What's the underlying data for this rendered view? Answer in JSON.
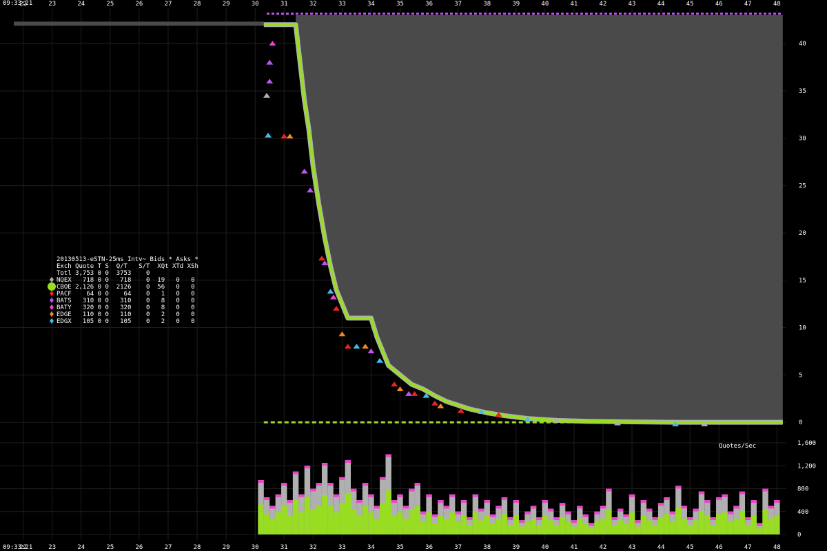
{
  "time_label": "09:33:21",
  "colors": {
    "background": "#000000",
    "grid": "#1e1e1e",
    "ask_area": "#4a4a4a",
    "NQEX": "#b0b0b0",
    "CBOE": "#99dd22",
    "PACF": "#ee2222",
    "BATS": "#bb55ee",
    "BATY": "#ee44cc",
    "EDGE": "#ee8822",
    "EDGX": "#44bbee"
  },
  "legend": {
    "title": "20130513-eSTN-25ms Intv~ Bids * Asks *",
    "header": "Exch Quote T S  Q/T   S/T  XQt XTd XSh",
    "total": "Totl 3,753 0 0  3753    0",
    "rows": [
      {
        "exch": "NQEX",
        "text": "NQEX   718 0 0   718    0  19   0   0",
        "color": "#b0b0b0",
        "big": false
      },
      {
        "exch": "CBOE",
        "text": "CBOE 2,126 0 0  2126    0  56   0   0",
        "color": "#99dd22",
        "big": true
      },
      {
        "exch": "PACF",
        "text": "PACF    64 0 0    64    0   1   0   0",
        "color": "#ee2222",
        "big": false
      },
      {
        "exch": "BATS",
        "text": "BATS   310 0 0   310    0   8   0   0",
        "color": "#bb55ee",
        "big": false
      },
      {
        "exch": "BATY",
        "text": "BATY   320 0 0   320    0   8   0   0",
        "color": "#ee44cc",
        "big": false
      },
      {
        "exch": "EDGE",
        "text": "EDGE   110 0 0   110    0   2   0   0",
        "color": "#ee8822",
        "big": false
      },
      {
        "exch": "EDGX",
        "text": "EDGX   105 0 0   105    0   2   0   0",
        "color": "#44bbee",
        "big": false
      }
    ]
  },
  "chart_data": [
    {
      "type": "line",
      "xlabel": "",
      "ylabel": "",
      "x_ticks": [
        "22",
        "23",
        "24",
        "25",
        "26",
        "27",
        "28",
        "29",
        "30",
        "31",
        "32",
        "33",
        "34",
        "35",
        "36",
        "37",
        "38",
        "39",
        "40",
        "41",
        "42",
        "43",
        "44",
        "45",
        "46",
        "47",
        "48"
      ],
      "xlim": [
        21.2,
        48.3
      ],
      "y_ticks": [
        0,
        5,
        10,
        15,
        20,
        25,
        30,
        35,
        40
      ],
      "ylim": [
        -0.5,
        43
      ],
      "grid": true,
      "ask_level": 43,
      "bid_series": {
        "name": "CBOE",
        "x": [
          30.3,
          31.4,
          31.55,
          31.7,
          31.85,
          32.0,
          32.2,
          32.4,
          32.6,
          32.8,
          33.0,
          33.2,
          33.4,
          33.6,
          33.8,
          34.0,
          34.2,
          34.4,
          34.6,
          35.0,
          35.4,
          35.8,
          36.2,
          36.6,
          37.0,
          37.4,
          38.0,
          38.6,
          39.4,
          40.4,
          41.5,
          43.0,
          44.5,
          46.0,
          48.2
        ],
        "y": [
          42,
          42,
          38,
          34,
          31,
          27,
          23,
          19.5,
          16.5,
          14,
          12.5,
          11,
          11,
          11,
          11,
          11,
          9,
          7.5,
          6,
          5,
          4,
          3.5,
          2.8,
          2.2,
          1.8,
          1.4,
          1.0,
          0.7,
          0.4,
          0.2,
          0.1,
          0.05,
          0,
          0,
          0
        ]
      },
      "markers": [
        {
          "exch": "NQEX",
          "x": 30.4,
          "y": 34.5
        },
        {
          "exch": "BATS",
          "x": 30.5,
          "y": 36
        },
        {
          "exch": "BATS",
          "x": 30.5,
          "y": 38
        },
        {
          "exch": "BATY",
          "x": 30.6,
          "y": 40
        },
        {
          "exch": "EDGX",
          "x": 30.45,
          "y": 30.3
        },
        {
          "exch": "EDGE",
          "x": 31.2,
          "y": 30.2
        },
        {
          "exch": "PACF",
          "x": 31.0,
          "y": 30.2
        },
        {
          "exch": "BATS",
          "x": 31.7,
          "y": 26.5
        },
        {
          "exch": "BATS",
          "x": 31.9,
          "y": 24.5
        },
        {
          "exch": "PACF",
          "x": 32.3,
          "y": 17.3
        },
        {
          "exch": "BATS",
          "x": 32.4,
          "y": 16.8
        },
        {
          "exch": "EDGX",
          "x": 32.6,
          "y": 13.8
        },
        {
          "exch": "BATY",
          "x": 32.7,
          "y": 13.2
        },
        {
          "exch": "PACF",
          "x": 32.8,
          "y": 12.0
        },
        {
          "exch": "EDGE",
          "x": 33.0,
          "y": 9.3
        },
        {
          "exch": "PACF",
          "x": 33.2,
          "y": 8.0
        },
        {
          "exch": "EDGX",
          "x": 33.5,
          "y": 8.0
        },
        {
          "exch": "EDGE",
          "x": 33.8,
          "y": 8.0
        },
        {
          "exch": "BATS",
          "x": 34.0,
          "y": 7.5
        },
        {
          "exch": "EDGX",
          "x": 34.3,
          "y": 6.5
        },
        {
          "exch": "PACF",
          "x": 34.8,
          "y": 4.0
        },
        {
          "exch": "EDGE",
          "x": 35.0,
          "y": 3.5
        },
        {
          "exch": "BATS",
          "x": 35.3,
          "y": 3.0
        },
        {
          "exch": "PACF",
          "x": 35.5,
          "y": 3.0
        },
        {
          "exch": "EDGX",
          "x": 35.9,
          "y": 2.8
        },
        {
          "exch": "PACF",
          "x": 36.2,
          "y": 2.0
        },
        {
          "exch": "EDGE",
          "x": 36.4,
          "y": 1.7
        },
        {
          "exch": "PACF",
          "x": 37.1,
          "y": 1.2
        },
        {
          "exch": "EDGX",
          "x": 37.8,
          "y": 1.1
        },
        {
          "exch": "PACF",
          "x": 38.4,
          "y": 0.8
        },
        {
          "exch": "EDGX",
          "x": 39.4,
          "y": 0.3
        },
        {
          "exch": "NQEX",
          "x": 40.4,
          "y": 0.2
        },
        {
          "exch": "NQEX",
          "x": 42.5,
          "y": -0.1
        },
        {
          "exch": "EDGX",
          "x": 44.5,
          "y": -0.2
        },
        {
          "exch": "NQEX",
          "x": 45.5,
          "y": -0.2
        }
      ]
    },
    {
      "type": "bar",
      "title": "Quotes/Sec",
      "y_ticks": [
        0,
        400,
        800,
        1200,
        1600
      ],
      "ylim": [
        0,
        1600
      ],
      "xlim": [
        21.2,
        48.3
      ],
      "x_ticks": [
        "22",
        "23",
        "24",
        "25",
        "26",
        "27",
        "28",
        "29",
        "30",
        "31",
        "32",
        "33",
        "34",
        "35",
        "36",
        "37",
        "38",
        "39",
        "40",
        "41",
        "42",
        "43",
        "44",
        "45",
        "46",
        "47",
        "48"
      ],
      "x": [
        30.2,
        30.4,
        30.6,
        30.8,
        31.0,
        31.2,
        31.4,
        31.6,
        31.8,
        32.0,
        32.2,
        32.4,
        32.6,
        32.8,
        33.0,
        33.2,
        33.4,
        33.6,
        33.8,
        34.0,
        34.2,
        34.4,
        34.6,
        34.8,
        35.0,
        35.2,
        35.4,
        35.6,
        35.8,
        36.0,
        36.2,
        36.4,
        36.6,
        36.8,
        37.0,
        37.2,
        37.4,
        37.6,
        37.8,
        38.0,
        38.2,
        38.4,
        38.6,
        38.8,
        39.0,
        39.2,
        39.4,
        39.6,
        39.8,
        40.0,
        40.2,
        40.4,
        40.6,
        40.8,
        41.0,
        41.2,
        41.4,
        41.6,
        41.8,
        42.0,
        42.2,
        42.4,
        42.6,
        42.8,
        43.0,
        43.2,
        43.4,
        43.6,
        43.8,
        44.0,
        44.2,
        44.4,
        44.6,
        44.8,
        45.0,
        45.2,
        45.4,
        45.6,
        45.8,
        46.0,
        46.2,
        46.4,
        46.6,
        46.8,
        47.0,
        47.2,
        47.4,
        47.6,
        47.8,
        48.0
      ],
      "values": [
        950,
        650,
        500,
        700,
        900,
        600,
        1100,
        700,
        1200,
        800,
        900,
        1250,
        900,
        700,
        1000,
        1300,
        800,
        600,
        900,
        700,
        500,
        1000,
        1400,
        600,
        700,
        500,
        800,
        900,
        400,
        700,
        350,
        600,
        500,
        700,
        400,
        600,
        300,
        700,
        450,
        600,
        350,
        500,
        650,
        300,
        600,
        250,
        400,
        500,
        300,
        600,
        450,
        300,
        550,
        400,
        250,
        500,
        350,
        200,
        400,
        500,
        800,
        300,
        450,
        350,
        700,
        250,
        600,
        450,
        300,
        550,
        650,
        400,
        850,
        500,
        300,
        450,
        750,
        600,
        300,
        650,
        700,
        400,
        500,
        750,
        300,
        600,
        200,
        800,
        500,
        600
      ]
    }
  ]
}
